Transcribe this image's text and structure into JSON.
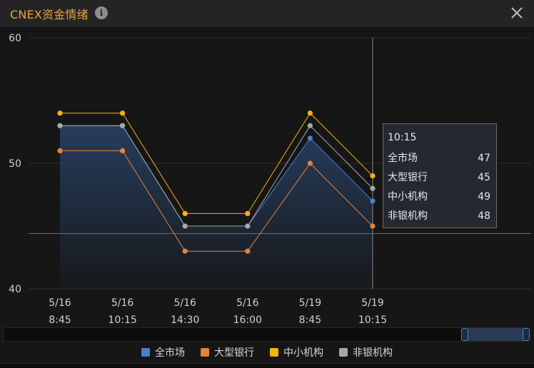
{
  "header": {
    "title": "CNEX资金情绪",
    "info_icon": "info-icon",
    "close_icon": "close-icon"
  },
  "colors": {
    "background": "#161616",
    "全市场": "#4a7fcc",
    "大型银行": "#e8823a",
    "中小机构": "#f5b20f",
    "非银机构": "#a8a8a8"
  },
  "chart_data": {
    "type": "line",
    "title": "",
    "x": [
      "5/16 8:45",
      "5/16 10:15",
      "5/16 14:30",
      "5/16 16:00",
      "5/19 8:45",
      "5/19 10:15"
    ],
    "x_ticks": [
      [
        "5/16",
        "8:45"
      ],
      [
        "5/16",
        "10:15"
      ],
      [
        "5/16",
        "14:30"
      ],
      [
        "5/16",
        "16:00"
      ],
      [
        "5/19",
        "8:45"
      ],
      [
        "5/19",
        "10:15"
      ]
    ],
    "yticks": [
      "60",
      "50",
      "40"
    ],
    "ylim": [
      40,
      60
    ],
    "grid": true,
    "series": [
      {
        "name": "全市场",
        "values": [
          53,
          53,
          45,
          45,
          52,
          47
        ]
      },
      {
        "name": "大型银行",
        "values": [
          51,
          51,
          43,
          43,
          50,
          45
        ]
      },
      {
        "name": "中小机构",
        "values": [
          54,
          54,
          46,
          46,
          54,
          49
        ]
      },
      {
        "name": "非银机构",
        "values": [
          53,
          53,
          45,
          45,
          53,
          48
        ]
      }
    ],
    "area_series": "全市场",
    "legend_position": "bottom",
    "crosshair": {
      "x_index": 5,
      "y": 44.4
    },
    "tooltip": {
      "title": "10:15",
      "rows": [
        {
          "name": "全市场",
          "value": "47"
        },
        {
          "name": "大型银行",
          "value": "45"
        },
        {
          "name": "中小机构",
          "value": "49"
        },
        {
          "name": "非银机构",
          "value": "48"
        }
      ]
    }
  },
  "data_zoom": {
    "start_fraction": 0.875,
    "end_fraction": 1.0
  }
}
